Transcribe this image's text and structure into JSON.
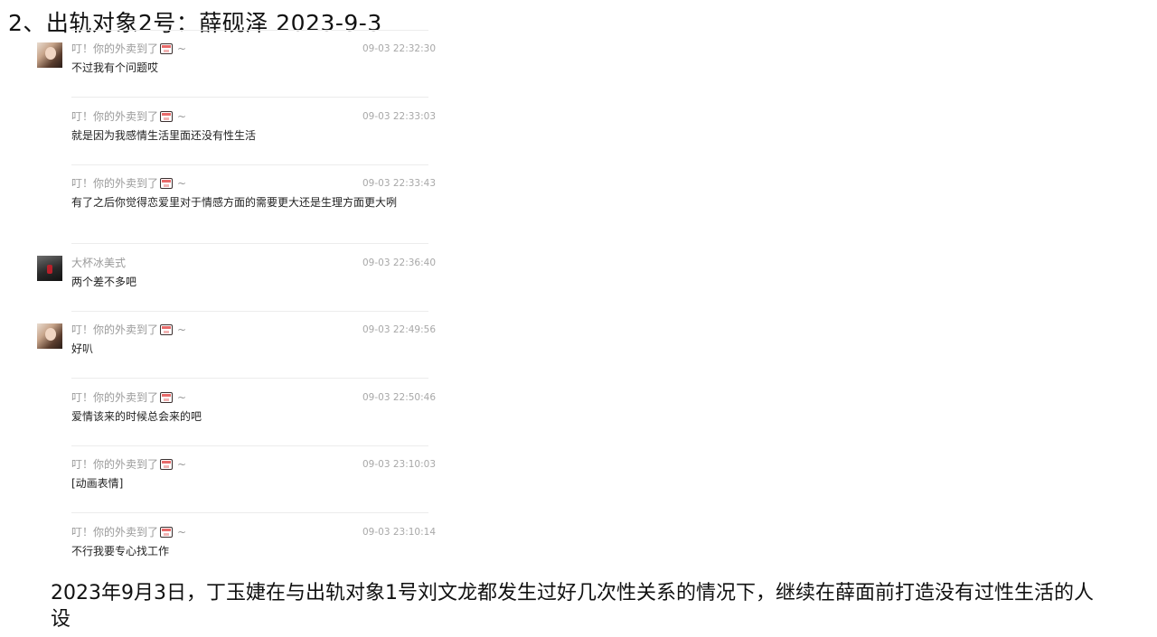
{
  "title": "2、出轨对象2号：薛砚泽  2023-9-3",
  "messages": [
    {
      "sender": "叮！你的外卖到了",
      "suffix": "~",
      "time": "09-03 22:32:30",
      "text": "不过我有个问题哎",
      "avatar": "girl-avatar"
    },
    {
      "sender": "叮！你的外卖到了",
      "suffix": "~",
      "time": "09-03 22:33:03",
      "text": "就是因为我感情生活里面还没有性生活",
      "avatar": ""
    },
    {
      "sender": "叮！你的外卖到了",
      "suffix": "~",
      "time": "09-03 22:33:43",
      "text": "有了之后你觉得恋爱里对于情感方面的需要更大还是生理方面更大咧",
      "avatar": ""
    },
    {
      "sender": "大杯冰美式",
      "suffix": "",
      "time": "09-03 22:36:40",
      "text": "两个差不多吧",
      "avatar": "dark-avatar"
    },
    {
      "sender": "叮！你的外卖到了",
      "suffix": "~",
      "time": "09-03 22:49:56",
      "text": "好叭",
      "avatar": "girl-avatar"
    },
    {
      "sender": "叮！你的外卖到了",
      "suffix": "~",
      "time": "09-03 22:50:46",
      "text": "爱情该来的时候总会来的吧",
      "avatar": ""
    },
    {
      "sender": "叮！你的外卖到了",
      "suffix": "~",
      "time": "09-03 23:10:03",
      "text": "[动画表情]",
      "avatar": ""
    },
    {
      "sender": "叮！你的外卖到了",
      "suffix": "~",
      "time": "09-03 23:10:14",
      "text": "不行我要专心找工作",
      "avatar": ""
    }
  ],
  "caption": "2023年9月3日，丁玉婕在与出轨对象1号刘文龙都发生过好几次性关系的情况下，继续在薛面前打造没有过性生活的人设",
  "icons": {
    "sender_badge": "takeout-bag-icon"
  }
}
